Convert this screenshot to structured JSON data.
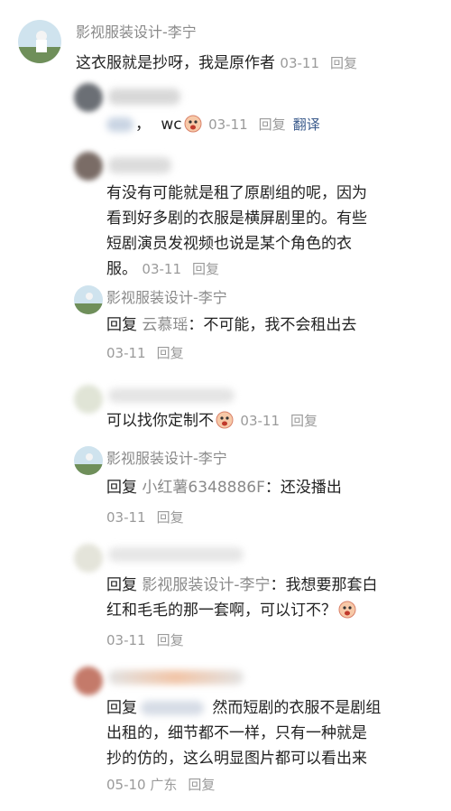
{
  "comments": [
    {
      "author": "影视服装设计-李宁",
      "text": "这衣服就是抄呀，我是原作者",
      "date": "03-11",
      "reply": "回复"
    },
    {
      "text_prefix": "，",
      "text": "wc",
      "date": "03-11",
      "reply": "回复",
      "translate": "翻译"
    },
    {
      "text": "有没有可能就是租了原剧组的呢，因为看到好多剧的衣服是横屏剧里的。有些短剧演员发视频也说是某个角色的衣服。",
      "lines": [
        "有没有可能就是租了原剧组的呢，因为",
        "看到好多剧的衣服是横屏剧里的。有些",
        "短剧演员发视频也说是某个角色的衣",
        "服。"
      ],
      "date": "03-11",
      "reply": "回复"
    },
    {
      "author": "影视服装设计-李宁",
      "reply_word": "回复",
      "mention": "云慕瑶",
      "text": "：不可能，我不会租出去",
      "date": "03-11",
      "reply": "回复"
    },
    {
      "text": "可以找你定制不",
      "date": "03-11",
      "reply": "回复"
    },
    {
      "author": "影视服装设计-李宁",
      "reply_word": "回复",
      "mention": "小红薯6348886F",
      "text": "：还没播出",
      "date": "03-11",
      "reply": "回复"
    },
    {
      "reply_word": "回复",
      "mention": "影视服装设计-李宁",
      "text": "：我想要那套白红和毛毛的那一套啊，可以订不？",
      "line1": "：我想要那套白",
      "line2": "红和毛毛的那一套啊，可以订不？",
      "date": "03-11",
      "reply": "回复"
    },
    {
      "reply_word": "回复",
      "text": "然而短剧的衣服不是剧组出租的，细节都不一样，只有一种就是抄的仿的，这么明显图片都可以看出来",
      "line1": "然而短剧的衣服不是剧组",
      "line2": "出租的，细节都不一样，只有一种就是",
      "line3": "抄的仿的，这么明显图片都可以看出来",
      "date": "05-10",
      "location": "广东",
      "reply": "回复"
    }
  ]
}
